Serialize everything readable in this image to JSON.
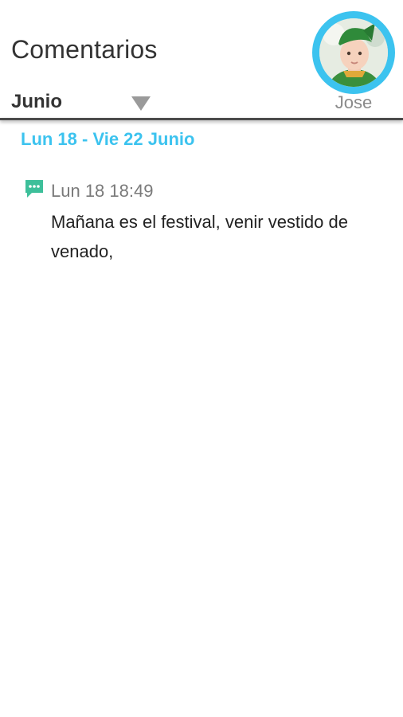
{
  "header": {
    "title": "Comentarios",
    "month_select": {
      "value": "Junio",
      "icon": "dropdown-triangle-icon"
    },
    "profile": {
      "name": "Jose",
      "ring_color": "#3cc3ef"
    }
  },
  "feed": {
    "weeks": [
      {
        "label": "Lun 18 - Vie 22 Junio",
        "comments": [
          {
            "icon": "chat-bubble-icon",
            "icon_color": "#3dbf9a",
            "time": "Lun 18 18:49",
            "text": "Mañana es el festival, venir vestido de venado,"
          }
        ]
      }
    ]
  },
  "colors": {
    "accent": "#3cc3ef",
    "comment_icon": "#3dbf9a",
    "title_text": "#333333",
    "muted_text": "#7a7a7a"
  }
}
